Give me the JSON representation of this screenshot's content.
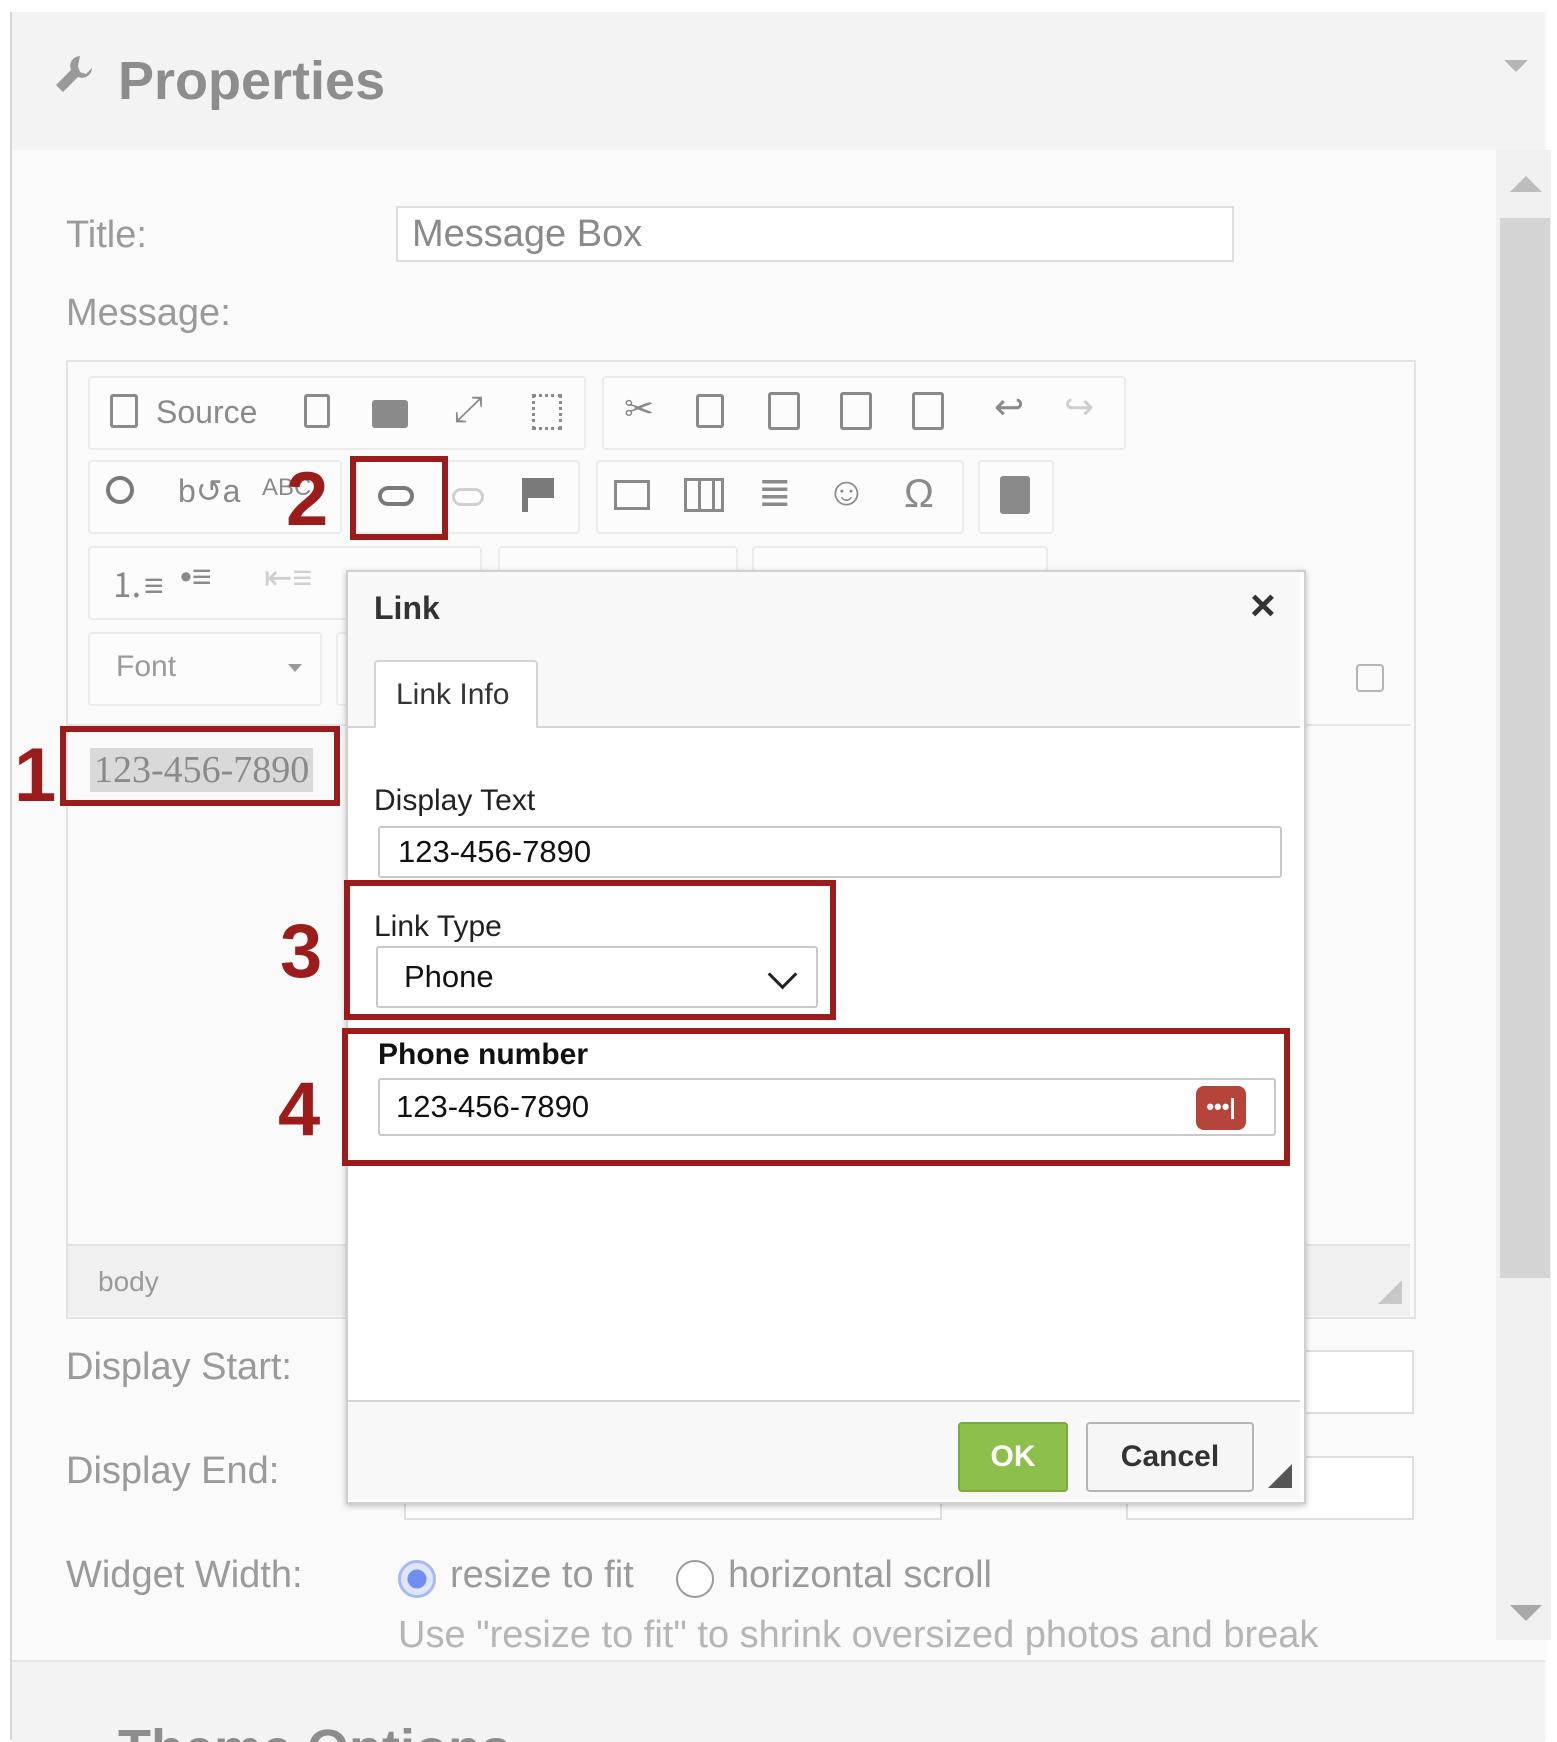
{
  "panel": {
    "title": "Properties",
    "next_section": "Theme Options"
  },
  "form": {
    "title_label": "Title:",
    "title_value": "Message Box",
    "message_label": "Message:",
    "display_start_label": "Display Start:",
    "display_end_label": "Display End:",
    "widget_width_label": "Widget Width:",
    "radio_resize": "resize to fit",
    "radio_scroll": "horizontal scroll",
    "help_text": "Use \"resize to fit\" to shrink oversized photos and break"
  },
  "editor": {
    "source_label": "Source",
    "font_label": "Font",
    "content_text": "123-456-7890",
    "status_path": "body"
  },
  "dialog": {
    "title": "Link",
    "close": "×",
    "tab": "Link Info",
    "display_text_label": "Display Text",
    "display_text_value": "123-456-7890",
    "link_type_label": "Link Type",
    "link_type_value": "Phone",
    "phone_label": "Phone number",
    "phone_value": "123-456-7890",
    "ok": "OK",
    "cancel": "Cancel"
  },
  "annotations": {
    "n1": "1",
    "n2": "2",
    "n3": "3",
    "n4": "4"
  },
  "colors": {
    "annotation": "#9c1b1b",
    "ok_button": "#8dc04a",
    "password_icon": "#b5443a",
    "radio_selected": "#6f8ef0"
  },
  "icons": [
    "wrench-icon",
    "source-icon",
    "preview-icon",
    "print-icon",
    "maximize-icon",
    "show-blocks-icon",
    "cut-icon",
    "copy-icon",
    "paste-icon",
    "paste-text-icon",
    "paste-word-icon",
    "undo-icon",
    "redo-icon",
    "find-icon",
    "replace-icon",
    "spellcheck-icon",
    "link-icon",
    "unlink-icon",
    "anchor-icon",
    "image-icon",
    "table-icon",
    "horizontal-rule-icon",
    "smiley-icon",
    "special-char-icon",
    "iframe-icon",
    "numbered-list-icon",
    "bulleted-list-icon",
    "outdent-icon",
    "close-icon",
    "chevron-down-icon",
    "password-icon"
  ]
}
